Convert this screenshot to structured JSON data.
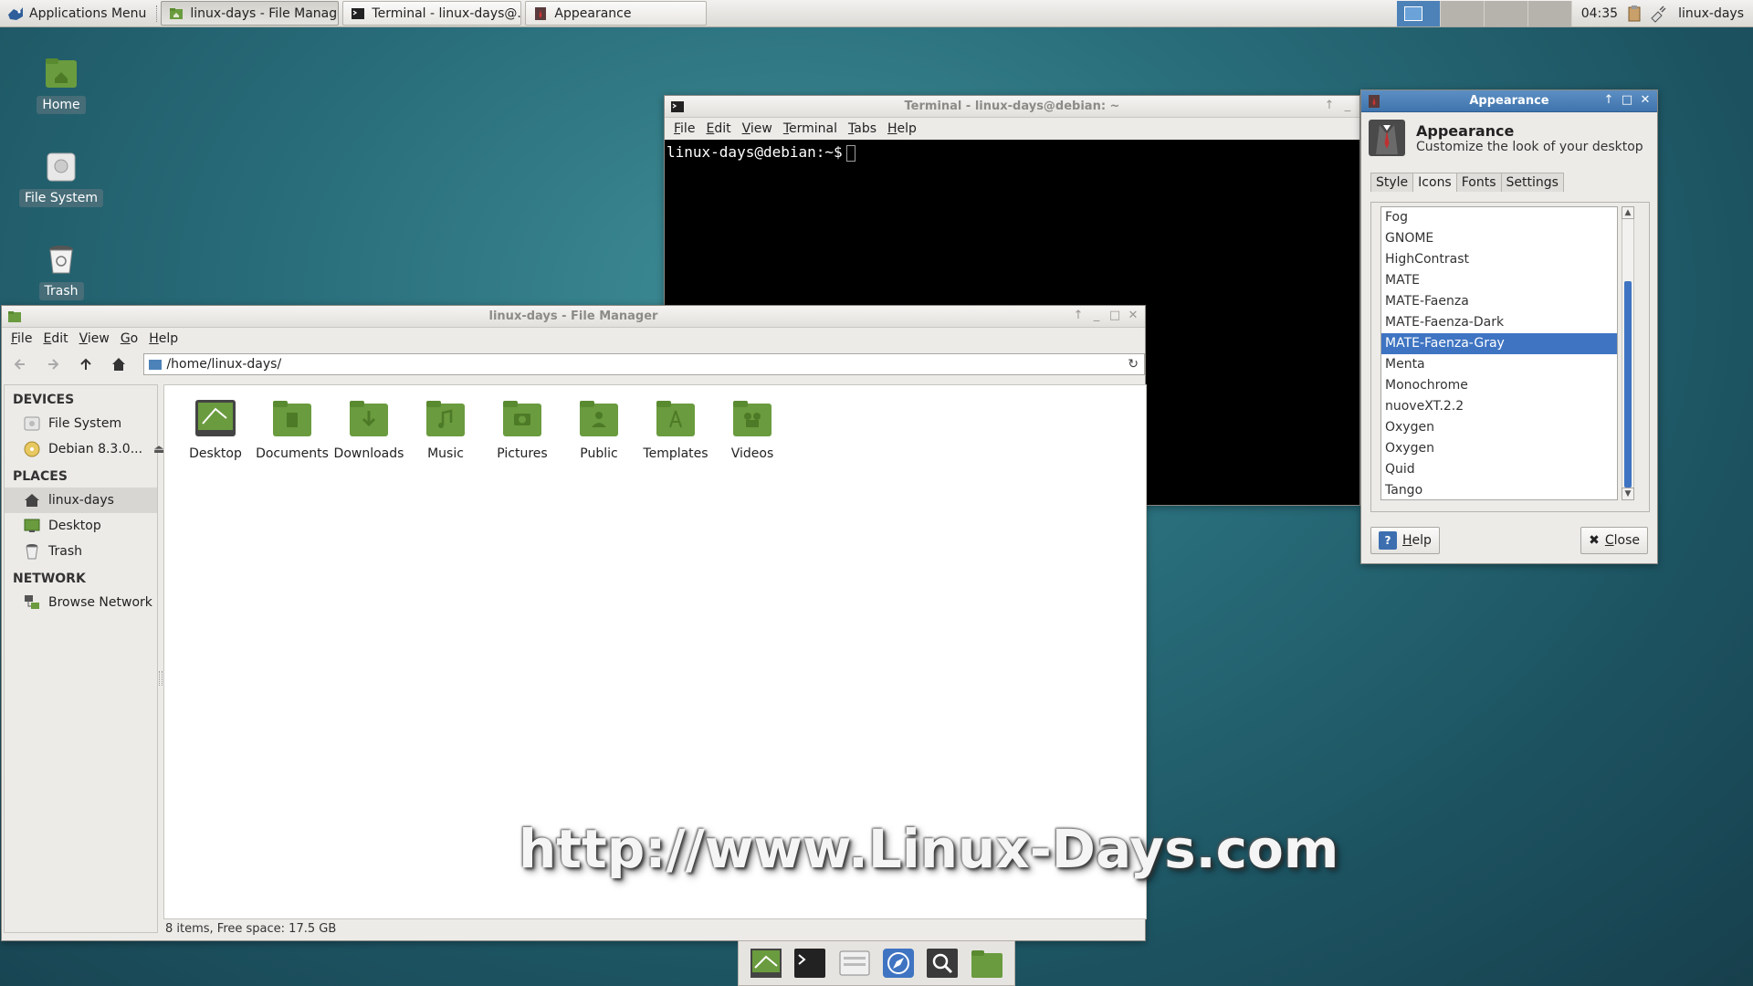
{
  "top_panel": {
    "apps_menu_label": "Applications Menu",
    "tasks": [
      {
        "label": "linux-days - File Manager",
        "icon": "folder-home-icon"
      },
      {
        "label": "Terminal - linux-days@...",
        "icon": "terminal-icon"
      },
      {
        "label": "Appearance",
        "icon": "appearance-icon"
      }
    ],
    "clock": "04:35",
    "user": "linux-days"
  },
  "desktop_icons": [
    {
      "label": "Home",
      "icon": "home-folder-icon"
    },
    {
      "label": "File System",
      "icon": "drive-icon"
    },
    {
      "label": "Trash",
      "icon": "trash-icon"
    }
  ],
  "terminal": {
    "title": "Terminal - linux-days@debian: ~",
    "menu": [
      "File",
      "Edit",
      "View",
      "Terminal",
      "Tabs",
      "Help"
    ],
    "prompt": "linux-days@debian:~$"
  },
  "file_manager": {
    "title": "linux-days - File Manager",
    "menu": [
      "File",
      "Edit",
      "View",
      "Go",
      "Help"
    ],
    "path": "/home/linux-days/",
    "sidebar": {
      "devices_header": "DEVICES",
      "devices": [
        {
          "label": "File System",
          "icon": "drive-icon"
        },
        {
          "label": "Debian 8.3.0...",
          "icon": "cdrom-icon"
        }
      ],
      "places_header": "PLACES",
      "places": [
        {
          "label": "linux-days",
          "icon": "home-icon"
        },
        {
          "label": "Desktop",
          "icon": "desktop-icon"
        },
        {
          "label": "Trash",
          "icon": "trash-icon"
        }
      ],
      "network_header": "NETWORK",
      "network": [
        {
          "label": "Browse Network",
          "icon": "network-icon"
        }
      ]
    },
    "folders": [
      "Desktop",
      "Documents",
      "Downloads",
      "Music",
      "Pictures",
      "Public",
      "Templates",
      "Videos"
    ],
    "status": "8 items, Free space: 17.5 GB"
  },
  "appearance": {
    "title": "Appearance",
    "heading": "Appearance",
    "subheading": "Customize the look of your desktop",
    "tabs": [
      "Style",
      "Icons",
      "Fonts",
      "Settings"
    ],
    "active_tab": "Icons",
    "icon_themes": [
      "Fog",
      "GNOME",
      "HighContrast",
      "MATE",
      "MATE-Faenza",
      "MATE-Faenza-Dark",
      "MATE-Faenza-Gray",
      "Menta",
      "Monochrome",
      "nuoveXT.2.2",
      "Oxygen",
      "Oxygen",
      "Quid",
      "Tango"
    ],
    "selected_theme": "MATE-Faenza-Gray",
    "help_label": "Help",
    "close_label": "Close"
  },
  "watermark": "http://www.Linux-Days.com",
  "dock": [
    "desktop-settings-icon",
    "terminal-icon",
    "file-manager-icon",
    "web-browser-icon",
    "search-icon",
    "folder-icon"
  ],
  "colors": {
    "accent": "#3f74c2",
    "folder_green": "#6a9b3e",
    "desktop_teal": "#2a6f7c"
  }
}
